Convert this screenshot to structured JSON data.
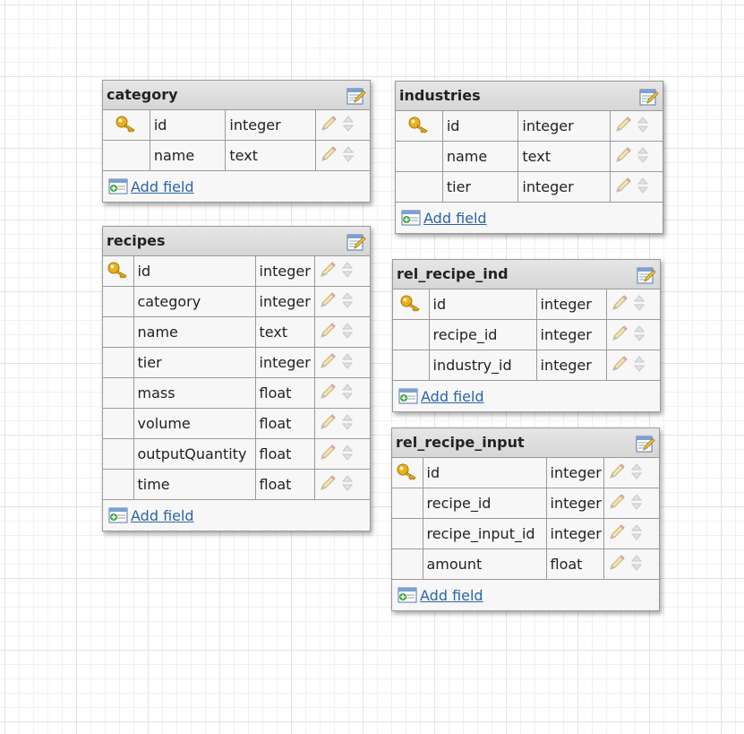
{
  "tables": [
    {
      "name": "category",
      "fields": [
        {
          "name": "id",
          "type": "integer",
          "key": true
        },
        {
          "name": "name",
          "type": "text",
          "key": false
        }
      ],
      "add_label": "Add field"
    },
    {
      "name": "industries",
      "fields": [
        {
          "name": "id",
          "type": "integer",
          "key": true
        },
        {
          "name": "name",
          "type": "text",
          "key": false
        },
        {
          "name": "tier",
          "type": "integer",
          "key": false
        }
      ],
      "add_label": "Add field"
    },
    {
      "name": "recipes",
      "fields": [
        {
          "name": "id",
          "type": "integer",
          "key": true
        },
        {
          "name": "category",
          "type": "integer",
          "key": false
        },
        {
          "name": "name",
          "type": "text",
          "key": false
        },
        {
          "name": "tier",
          "type": "integer",
          "key": false
        },
        {
          "name": "mass",
          "type": "float",
          "key": false
        },
        {
          "name": "volume",
          "type": "float",
          "key": false
        },
        {
          "name": "outputQuantity",
          "type": "float",
          "key": false
        },
        {
          "name": "time",
          "type": "float",
          "key": false
        }
      ],
      "add_label": "Add field"
    },
    {
      "name": "rel_recipe_ind",
      "fields": [
        {
          "name": "id",
          "type": "integer",
          "key": true
        },
        {
          "name": "recipe_id",
          "type": "integer",
          "key": false
        },
        {
          "name": "industry_id",
          "type": "integer",
          "key": false
        }
      ],
      "add_label": "Add field"
    },
    {
      "name": "rel_recipe_input",
      "fields": [
        {
          "name": "id",
          "type": "integer",
          "key": true
        },
        {
          "name": "recipe_id",
          "type": "integer",
          "key": false
        },
        {
          "name": "recipe_input_id",
          "type": "integer",
          "key": false
        },
        {
          "name": "amount",
          "type": "float",
          "key": false
        }
      ],
      "add_label": "Add field"
    }
  ],
  "icons": {
    "primary_key": "key-icon",
    "edit_table": "edit-table-icon",
    "edit_field": "pencil-icon",
    "reorder_field": "up-down-arrows-icon",
    "add_field": "add-field-icon"
  },
  "colors": {
    "link": "#2a64a8",
    "key": "#e8b020",
    "header": "#d9d9d9",
    "border": "#9a9a9a"
  }
}
